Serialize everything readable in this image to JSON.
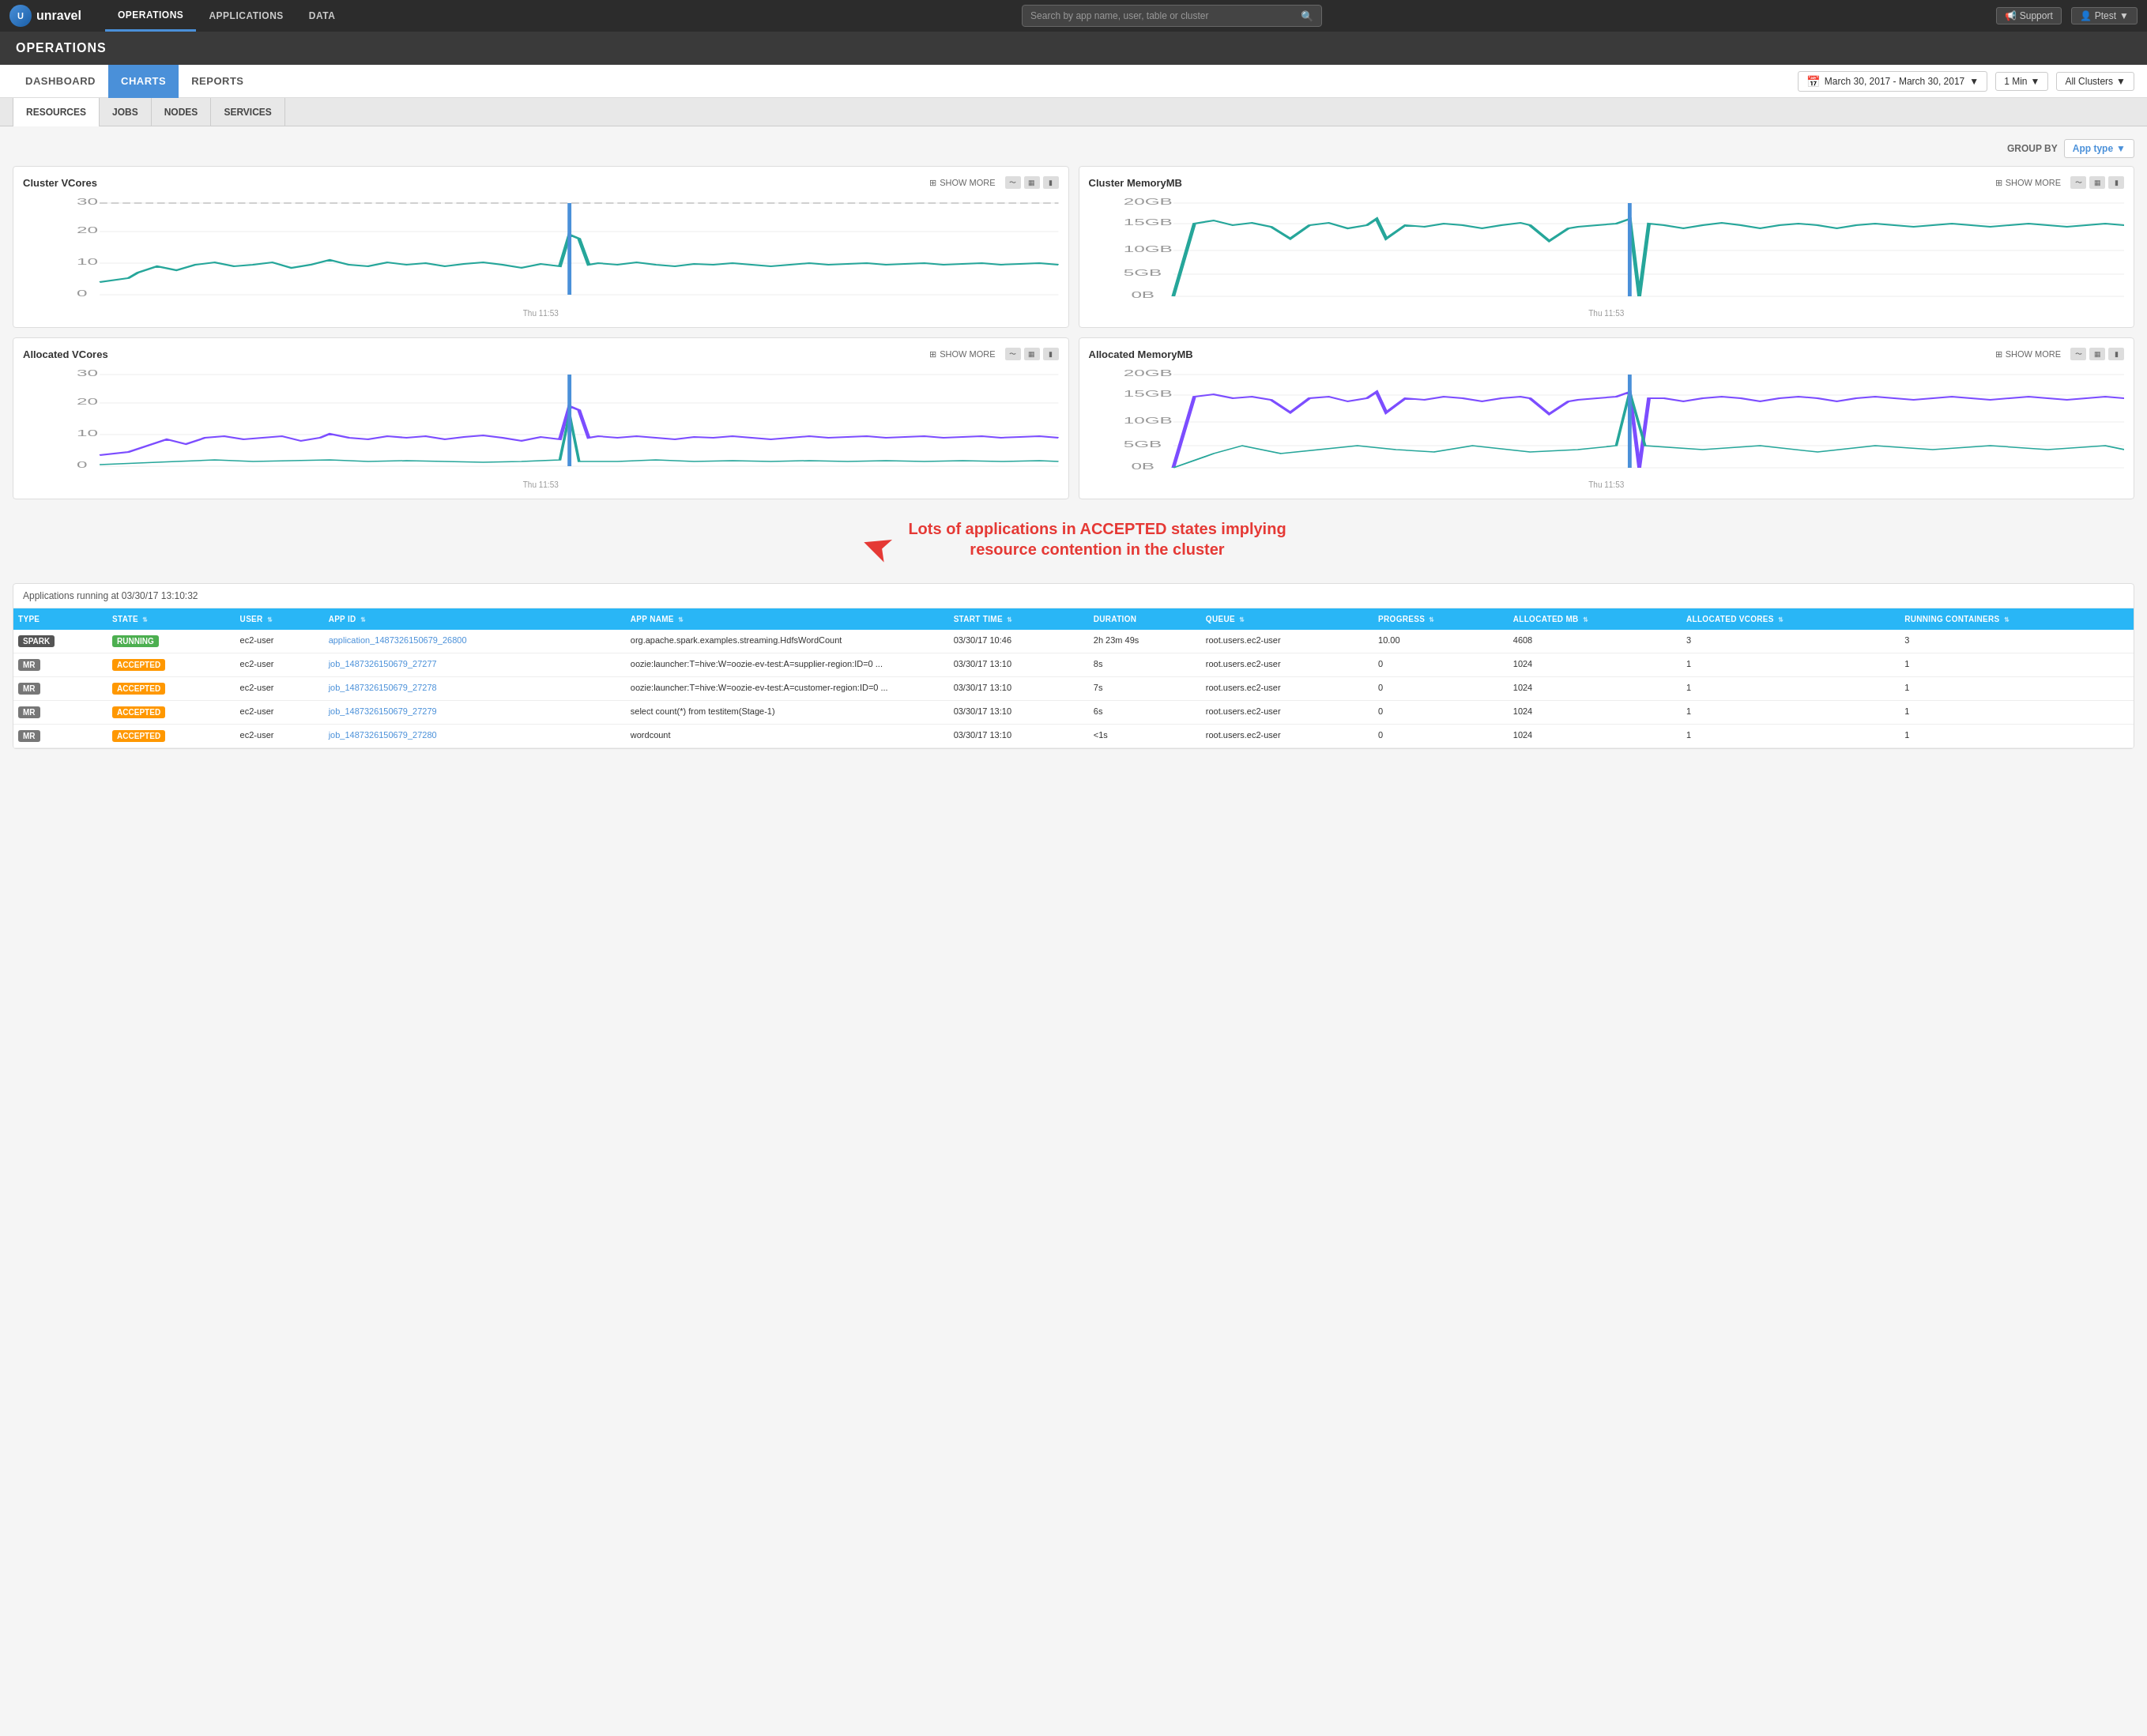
{
  "nav": {
    "logo": "unravel",
    "links": [
      "OPERATIONS",
      "APPLICATIONS",
      "DATA"
    ],
    "active_link": "OPERATIONS",
    "search_placeholder": "Search by app name, user, table or cluster",
    "support_label": "Support",
    "user_label": "Ptest"
  },
  "ops_header": {
    "title": "OPERATIONS"
  },
  "tabs": {
    "items": [
      "DASHBOARD",
      "CHARTS",
      "REPORTS"
    ],
    "active": "CHARTS",
    "date_label": "March 30, 2017 - March 30, 2017",
    "interval_label": "1 Min",
    "cluster_label": "All Clusters"
  },
  "sub_tabs": {
    "items": [
      "RESOURCES",
      "JOBS",
      "NODES",
      "SERVICES"
    ],
    "active": "RESOURCES"
  },
  "group_by": {
    "label": "GROUP BY",
    "value": "App type"
  },
  "charts": [
    {
      "id": "cluster-vcores",
      "title": "Cluster VCores",
      "show_more": "SHOW MORE",
      "timestamp": "Thu 11:53",
      "type": "line",
      "color": "#26a69a",
      "y_max": 30,
      "y_labels": [
        "30",
        "20",
        "10",
        "0"
      ]
    },
    {
      "id": "cluster-memorymb",
      "title": "Cluster MemoryMB",
      "show_more": "SHOW MORE",
      "timestamp": "Thu 11:53",
      "type": "line",
      "color": "#26a69a",
      "y_max": "20GB",
      "y_labels": [
        "20GB",
        "15GB",
        "10GB",
        "5GB",
        "0B"
      ]
    },
    {
      "id": "allocated-vcores",
      "title": "Allocated VCores",
      "show_more": "SHOW MORE",
      "timestamp": "Thu 11:53",
      "type": "line",
      "color": "#7c4dff",
      "color2": "#26a69a",
      "y_max": 30,
      "y_labels": [
        "30",
        "20",
        "10",
        "0"
      ]
    },
    {
      "id": "allocated-memorymb",
      "title": "Allocated MemoryMB",
      "show_more": "SHOW MORE",
      "timestamp": "Thu 11:53",
      "type": "line",
      "color": "#7c4dff",
      "color2": "#26a69a",
      "y_max": "20GB",
      "y_labels": [
        "20GB",
        "15GB",
        "10GB",
        "5GB",
        "0B"
      ]
    }
  ],
  "annotation": {
    "text": "Lots of applications in ACCEPTED states implying\nresource contention in the cluster"
  },
  "applications": {
    "header": "Applications running at 03/30/17 13:10:32",
    "columns": [
      {
        "key": "type",
        "label": "TYPE"
      },
      {
        "key": "state",
        "label": "STATE"
      },
      {
        "key": "user",
        "label": "USER"
      },
      {
        "key": "app_id",
        "label": "APP ID"
      },
      {
        "key": "app_name",
        "label": "APP NAME"
      },
      {
        "key": "start_time",
        "label": "START TIME"
      },
      {
        "key": "duration",
        "label": "DURATION"
      },
      {
        "key": "queue",
        "label": "QUEUE"
      },
      {
        "key": "progress",
        "label": "PROGRESS"
      },
      {
        "key": "allocated_mb",
        "label": "ALLOCATED MB"
      },
      {
        "key": "allocated_vcores",
        "label": "ALLOCATED VCORES"
      },
      {
        "key": "running_containers",
        "label": "RUNNING CONTAINERS"
      }
    ],
    "rows": [
      {
        "type": "SPARK",
        "type_badge": "spark",
        "state": "RUNNING",
        "state_badge": "running",
        "user": "ec2-user",
        "app_id": "application_1487326150679_26800",
        "app_name": "org.apache.spark.examples.streaming.HdfsWordCount",
        "start_time": "03/30/17 10:46",
        "duration": "2h 23m 49s",
        "queue": "root.users.ec2-user",
        "progress": "10.00",
        "allocated_mb": "4608",
        "allocated_vcores": "3",
        "running_containers": "3"
      },
      {
        "type": "MR",
        "type_badge": "mr",
        "state": "ACCEPTED",
        "state_badge": "accepted",
        "user": "ec2-user",
        "app_id": "job_1487326150679_27277",
        "app_name": "oozie:launcher:T=hive:W=oozie-ev-test:A=supplier-region:ID=0 ...",
        "start_time": "03/30/17 13:10",
        "duration": "8s",
        "queue": "root.users.ec2-user",
        "progress": "0",
        "allocated_mb": "1024",
        "allocated_vcores": "1",
        "running_containers": "1"
      },
      {
        "type": "MR",
        "type_badge": "mr",
        "state": "ACCEPTED",
        "state_badge": "accepted",
        "user": "ec2-user",
        "app_id": "job_1487326150679_27278",
        "app_name": "oozie:launcher:T=hive:W=oozie-ev-test:A=customer-region:ID=0 ...",
        "start_time": "03/30/17 13:10",
        "duration": "7s",
        "queue": "root.users.ec2-user",
        "progress": "0",
        "allocated_mb": "1024",
        "allocated_vcores": "1",
        "running_containers": "1"
      },
      {
        "type": "MR",
        "type_badge": "mr",
        "state": "ACCEPTED",
        "state_badge": "accepted",
        "user": "ec2-user",
        "app_id": "job_1487326150679_27279",
        "app_name": "select count(*) from testitem(Stage-1)",
        "start_time": "03/30/17 13:10",
        "duration": "6s",
        "queue": "root.users.ec2-user",
        "progress": "0",
        "allocated_mb": "1024",
        "allocated_vcores": "1",
        "running_containers": "1"
      },
      {
        "type": "MR",
        "type_badge": "mr",
        "state": "ACCEPTED",
        "state_badge": "accepted",
        "user": "ec2-user",
        "app_id": "job_1487326150679_27280",
        "app_name": "wordcount",
        "start_time": "03/30/17 13:10",
        "duration": "<1s",
        "queue": "root.users.ec2-user",
        "progress": "0",
        "allocated_mb": "1024",
        "allocated_vcores": "1",
        "running_containers": "1"
      }
    ]
  }
}
